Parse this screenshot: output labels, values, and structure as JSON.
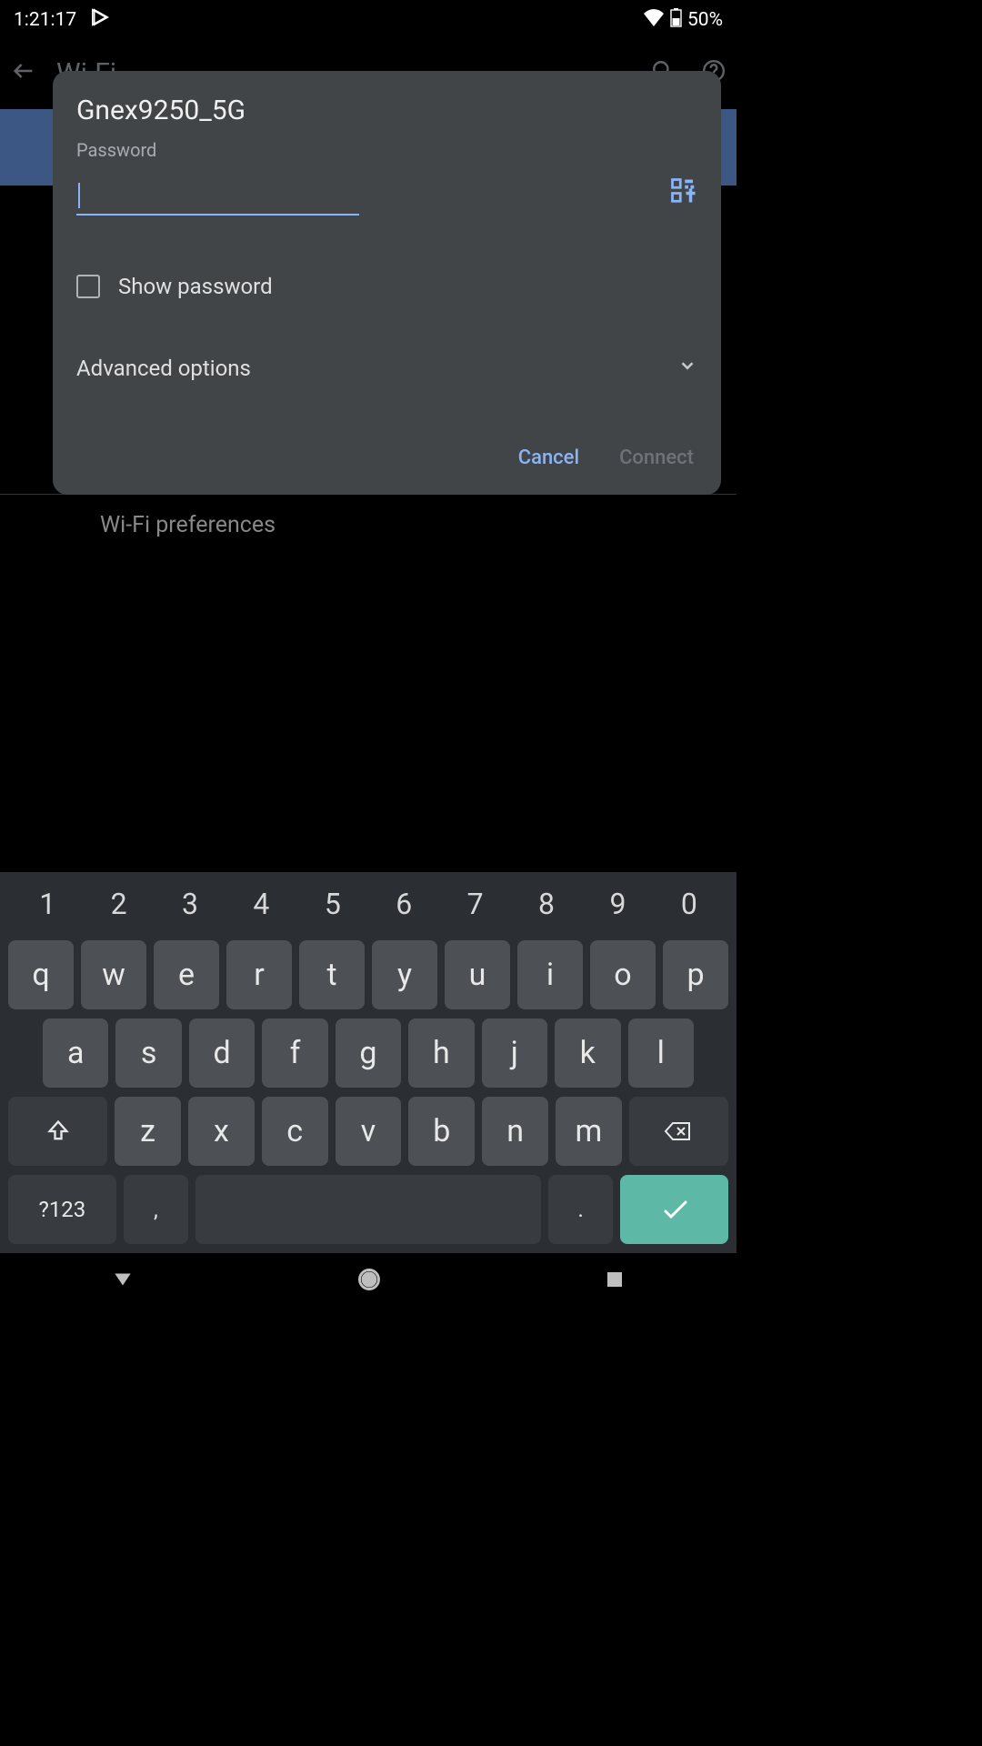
{
  "status_bar": {
    "time": "1:21:17",
    "battery_text": "50%"
  },
  "header": {
    "title": "Wi-Fi"
  },
  "dialog": {
    "network_name": "Gnex9250_5G",
    "field_label": "Password",
    "password_value": "",
    "show_password_label": "Show password",
    "advanced_label": "Advanced options",
    "cancel_label": "Cancel",
    "connect_label": "Connect"
  },
  "background": {
    "preferences_label": "Wi-Fi preferences"
  },
  "keyboard": {
    "num_row": [
      "1",
      "2",
      "3",
      "4",
      "5",
      "6",
      "7",
      "8",
      "9",
      "0"
    ],
    "row1": [
      "q",
      "w",
      "e",
      "r",
      "t",
      "y",
      "u",
      "i",
      "o",
      "p"
    ],
    "row2": [
      "a",
      "s",
      "d",
      "f",
      "g",
      "h",
      "j",
      "k",
      "l"
    ],
    "row3": [
      "z",
      "x",
      "c",
      "v",
      "b",
      "n",
      "m"
    ],
    "symbol_key": "?123",
    "comma": ",",
    "period": "."
  }
}
